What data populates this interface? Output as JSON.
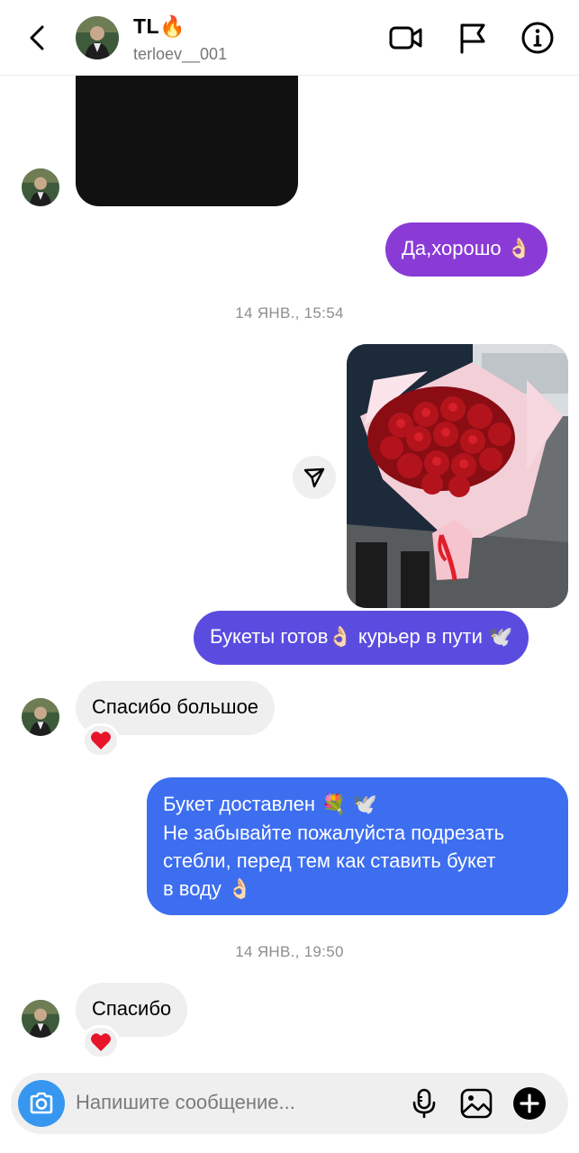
{
  "header": {
    "name": "TL",
    "name_emoji": "🔥",
    "username": "terloev__001"
  },
  "messages": {
    "m1": "Да,хорошо",
    "m1_emoji": "👌🏻",
    "timestamp1": "14 ЯНВ., 15:54",
    "m2_a": "Букеты готов",
    "m2_e1": "👌🏻",
    "m2_b": " курьер в пути ",
    "m2_e2": "🕊️",
    "m3": "Спасибо большое",
    "m4_line1": "Букет доставлен",
    "m4_line1_emoji": " 💐 🕊️",
    "m4_line2": "Не забывайте пожалуйста подрезать",
    "m4_line3": "стебли, перед тем как ставить букет",
    "m4_line4": "в воду",
    "m4_line4_emoji": " 👌🏻",
    "timestamp2": "14 ЯНВ., 19:50",
    "m5": "Спасибо",
    "reaction": "❤️"
  },
  "composer": {
    "placeholder": "Напишите сообщение..."
  },
  "icons": {
    "back": "chevron-left-icon",
    "video": "video-camera-icon",
    "flag": "flag-icon",
    "info": "info-icon",
    "share": "paper-plane-icon",
    "camera": "camera-icon",
    "mic": "microphone-icon",
    "gallery": "image-icon",
    "plus": "plus-circle-icon"
  },
  "colors": {
    "accent_purple": "#8a3bd6",
    "accent_violet": "#5b4ce0",
    "accent_blue": "#3d6ef0",
    "camera_blue": "#3797f0",
    "incoming_bg": "#efefef"
  }
}
